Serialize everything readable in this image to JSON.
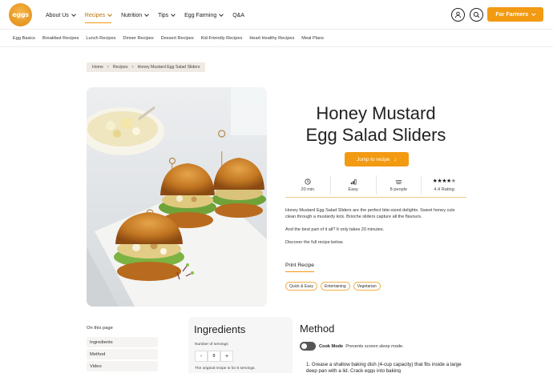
{
  "brand": {
    "logo_text": "eggs",
    "accent": "#f29a12",
    "accent_dark": "#b5720a"
  },
  "nav": {
    "items": [
      {
        "label": "About Us",
        "has_dropdown": true,
        "active": false
      },
      {
        "label": "Recipes",
        "has_dropdown": true,
        "active": true
      },
      {
        "label": "Nutrition",
        "has_dropdown": true,
        "active": false
      },
      {
        "label": "Tips",
        "has_dropdown": true,
        "active": false
      },
      {
        "label": "Egg Farming",
        "has_dropdown": true,
        "active": false
      },
      {
        "label": "Q&A",
        "has_dropdown": false,
        "active": false
      }
    ],
    "account_icon": "user-icon",
    "search_icon": "search-icon",
    "for_farmers_label": "For Farmers"
  },
  "subnav": [
    "Egg Basics",
    "Breakfast Recipes",
    "Lunch Recipes",
    "Dinner Recipes",
    "Dessert Recipes",
    "Kid-Friendly Recipes",
    "Heart Healthy Recipes",
    "Meal Plans"
  ],
  "breadcrumb": {
    "home": "Home",
    "recipes": "Recipes",
    "current": "Honey Mustard Egg Salad Sliders"
  },
  "recipe": {
    "title_line1": "Honey Mustard",
    "title_line2": "Egg Salad Sliders",
    "jump_label": "Jump to recipe",
    "stats": {
      "time": "20 min",
      "difficulty": "Easy",
      "servings": "8 people",
      "rating_label": "4.4 Rating",
      "rating_value": 4.4
    },
    "description": [
      "Honey Mustard Egg Salad Sliders are the perfect bite-sized delights. Sweet honey cuts clean through a mustardy kick. Brioche sliders capture all the flavours.",
      "And the best part of it all? It only takes 20 minutes.",
      "Discover the full recipe below."
    ],
    "print_label": "Print Recipe",
    "tags": [
      "Quick & Easy",
      "Entertaining",
      "Vegetarian"
    ]
  },
  "on_page": {
    "heading": "On this page",
    "items": [
      "Ingredients",
      "Method",
      "Video"
    ]
  },
  "ingredients": {
    "title": "Ingredients",
    "servings_label": "Number of servings",
    "servings_value": "8",
    "minus": "-",
    "plus": "+",
    "note": "The original recipe is for 8 servings."
  },
  "method": {
    "title": "Method",
    "cook_mode_label": "Cook Mode",
    "cook_mode_hint": "Prevents screen sleep mode.",
    "step1": "1. Grease a shallow baking dish (4-cup capacity) that fits inside a large deep pan with a lid. Crack eggs into baking"
  }
}
